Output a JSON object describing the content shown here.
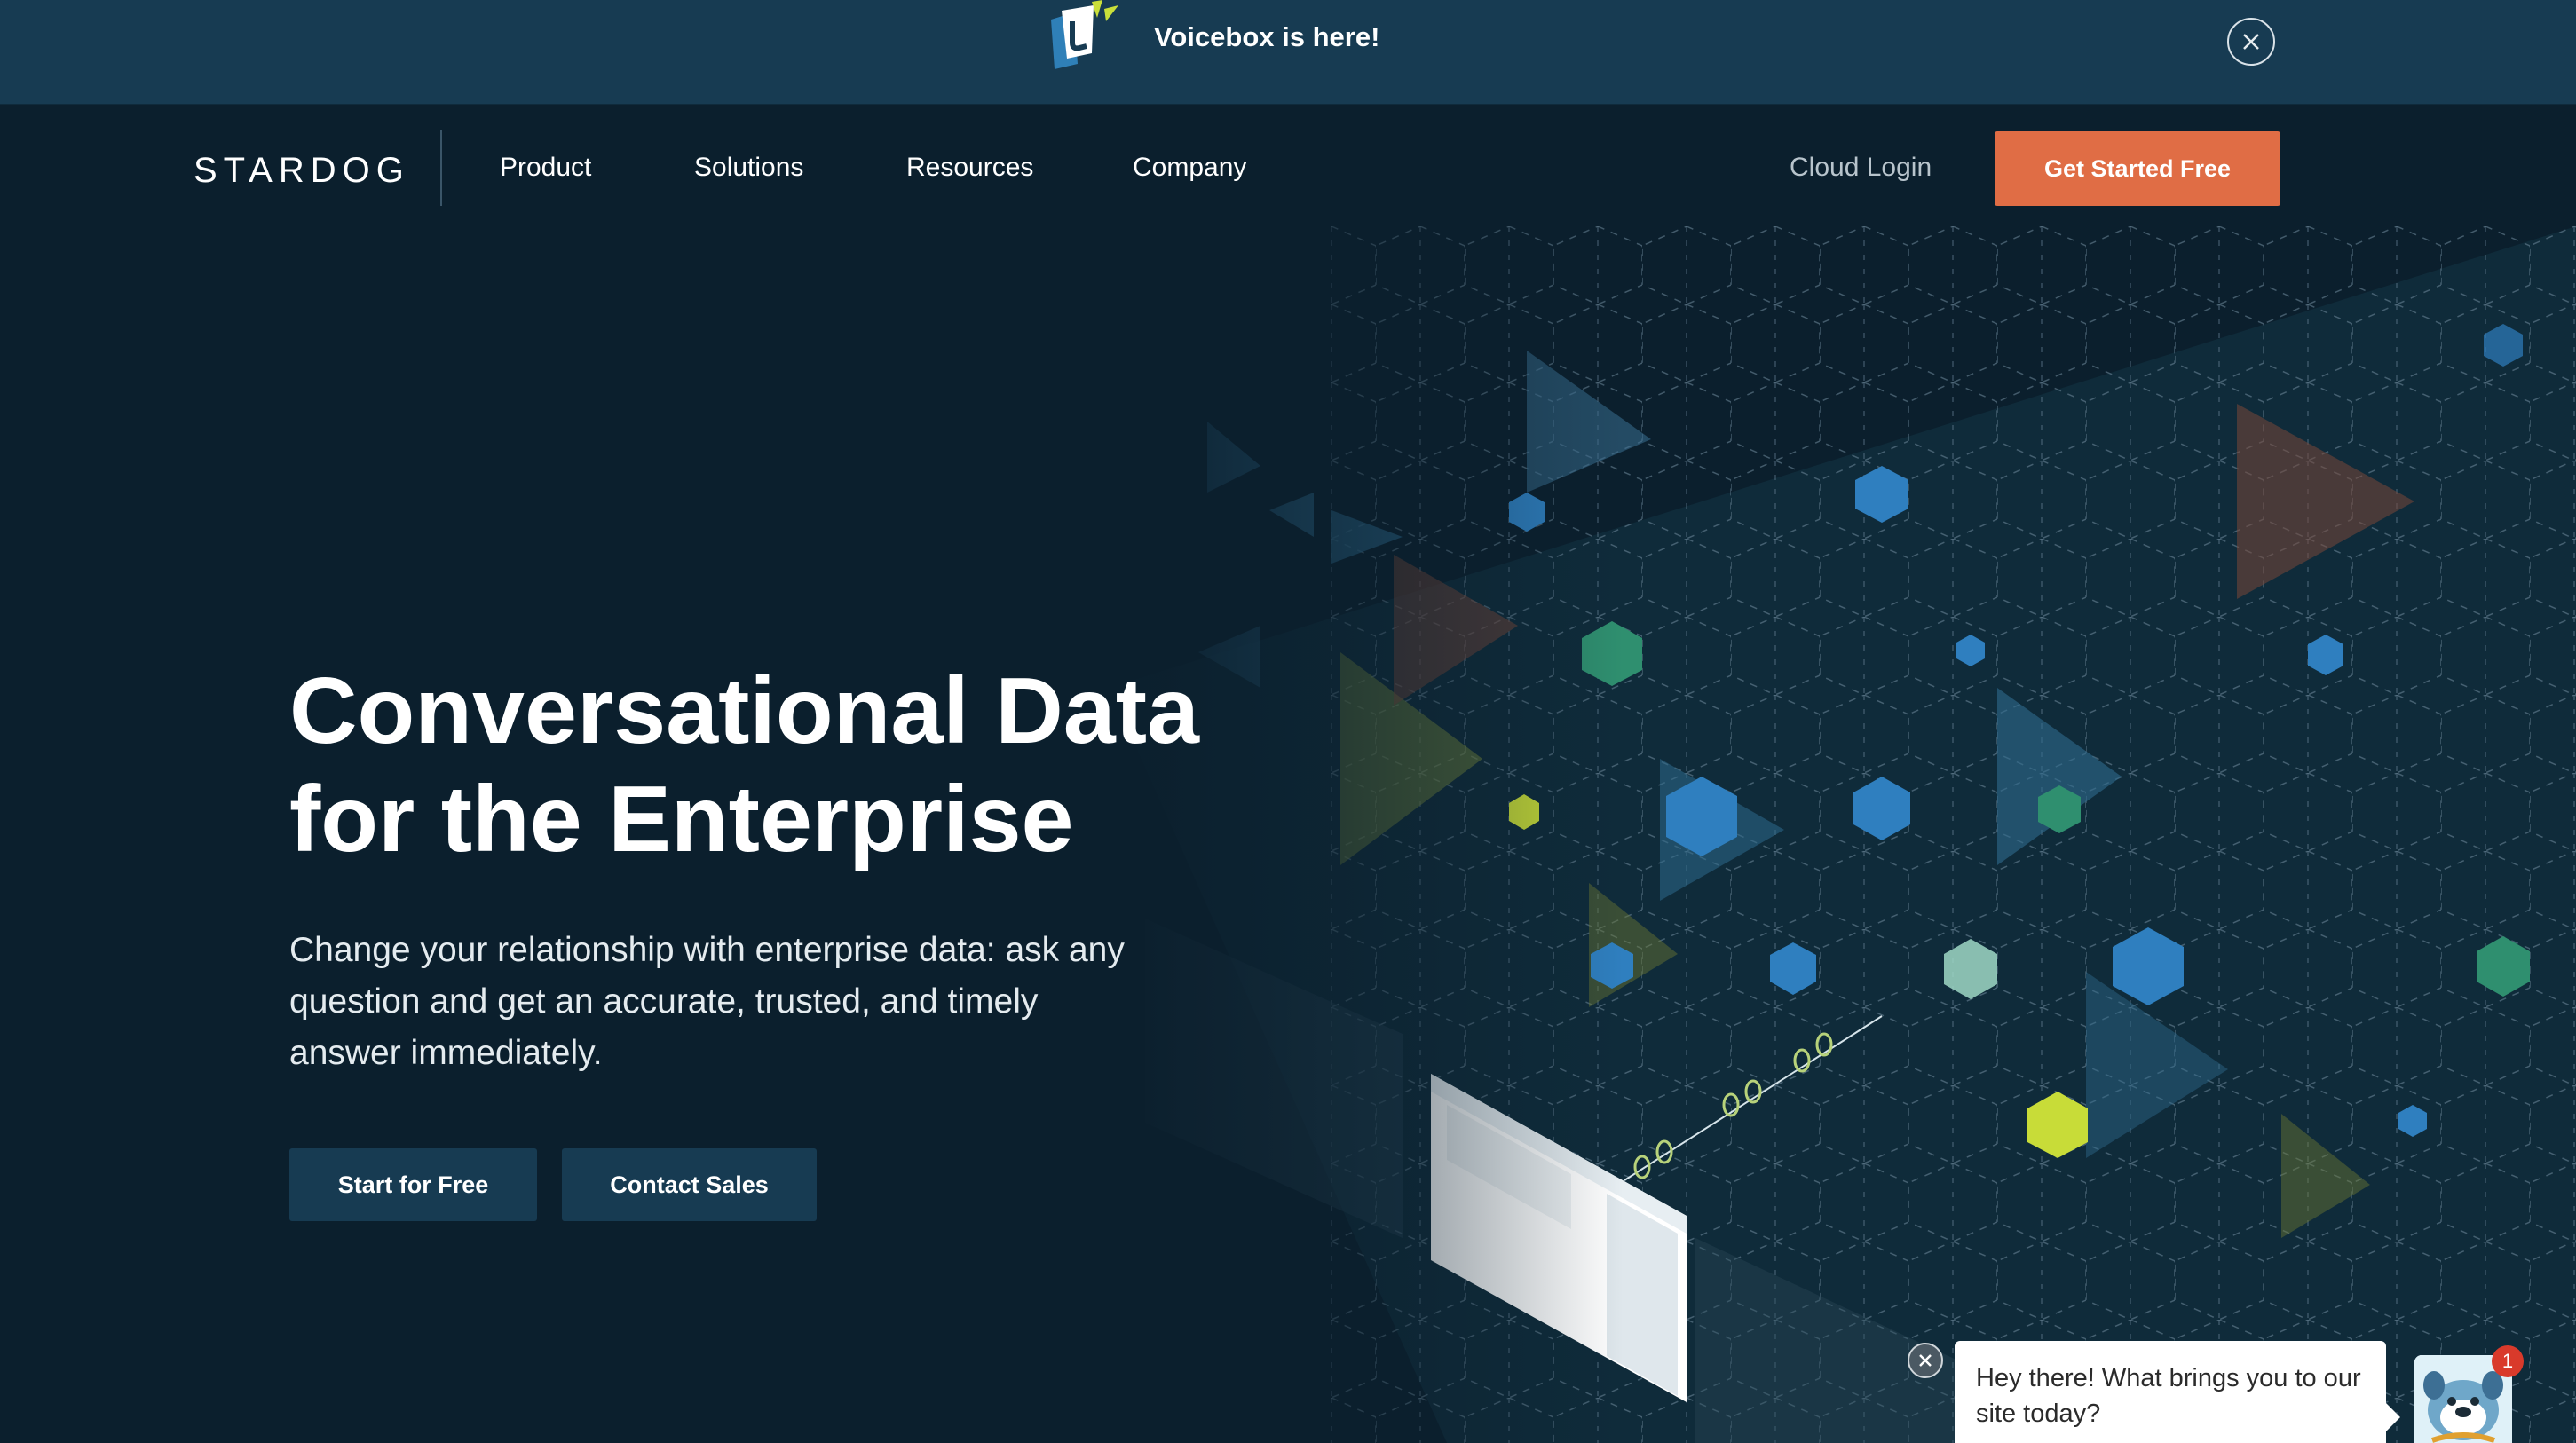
{
  "announcement": {
    "text": "Voicebox is here!",
    "close_icon": "close-icon"
  },
  "nav": {
    "brand": "STARDOG",
    "items": [
      {
        "label": "Product"
      },
      {
        "label": "Solutions"
      },
      {
        "label": "Resources"
      },
      {
        "label": "Company"
      }
    ],
    "cloud_login": "Cloud Login",
    "cta": "Get Started Free"
  },
  "hero": {
    "headline_line1": "Conversational Data",
    "headline_line2": "for the Enterprise",
    "subtext": "Change your relationship with enterprise data: ask any question and get an accurate, trusted, and timely answer immediately.",
    "primary_button": "Start for Free",
    "secondary_button": "Contact Sales"
  },
  "chat": {
    "message": "Hey there! What brings you to our site today?",
    "badge_count": "1"
  },
  "colors": {
    "background": "#0b1f2d",
    "announcement_bar": "#173b52",
    "cta_orange": "#e06d45",
    "button_dark": "#173b52"
  }
}
